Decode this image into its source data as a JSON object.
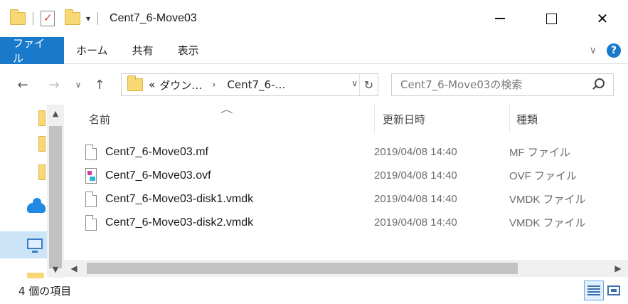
{
  "window": {
    "title": "Cent7_6-Move03",
    "qat_dropdown_glyph": "▾",
    "close_glyph": "✕"
  },
  "ribbon": {
    "tabs": [
      {
        "label": "ファイル",
        "active": true
      },
      {
        "label": "ホーム"
      },
      {
        "label": "共有"
      },
      {
        "label": "表示"
      }
    ],
    "collapse_glyph": "∨",
    "help_glyph": "?"
  },
  "nav": {
    "back_glyph": "←",
    "forward_glyph": "→",
    "recent_glyph": "∨",
    "up_glyph": "↑"
  },
  "address": {
    "crumbs": [
      "«",
      "ダウン…",
      "›",
      "Cent7_6-…"
    ],
    "dropdown_glyph": "∨",
    "refresh_glyph": "↻"
  },
  "search": {
    "placeholder": "Cent7_6-Move03の検索"
  },
  "columns": {
    "sort_glyph": "︿",
    "name": "名前",
    "date": "更新日時",
    "type": "種類"
  },
  "files": [
    {
      "name": "Cent7_6-Move03.mf",
      "date": "2019/04/08 14:40",
      "type": "MF ファイル",
      "icon": "generic-file-icon"
    },
    {
      "name": "Cent7_6-Move03.ovf",
      "date": "2019/04/08 14:40",
      "type": "OVF ファイル",
      "icon": "ovf-file-icon"
    },
    {
      "name": "Cent7_6-Move03-disk1.vmdk",
      "date": "2019/04/08 14:40",
      "type": "VMDK ファイル",
      "icon": "generic-file-icon"
    },
    {
      "name": "Cent7_6-Move03-disk2.vmdk",
      "date": "2019/04/08 14:40",
      "type": "VMDK ファイル",
      "icon": "generic-file-icon"
    }
  ],
  "scroll": {
    "up_glyph": "▲",
    "down_glyph": "▼",
    "left_glyph": "◀",
    "right_glyph": "▶"
  },
  "status": {
    "item_count": "4 個の項目"
  },
  "colors": {
    "accent": "#1979ca",
    "folder": "#f8d775",
    "selection": "#cce4f7"
  }
}
